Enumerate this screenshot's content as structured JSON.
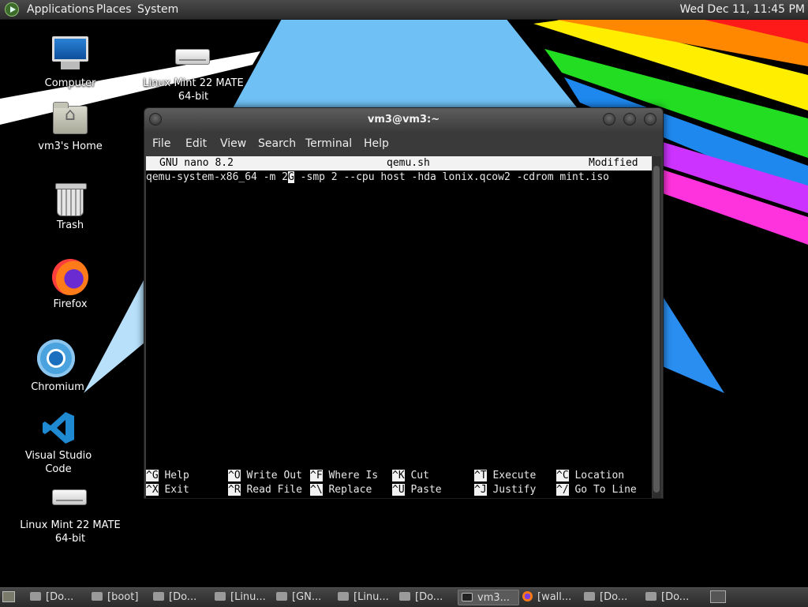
{
  "top_panel": {
    "menus": [
      "Applications",
      "Places",
      "System"
    ],
    "clock": "Wed Dec 11, 11:45 PM"
  },
  "desktop_icons": [
    {
      "label": "Computer",
      "icon": "computer-icon"
    },
    {
      "label": "Linux Mint 22 MATE 64-bit",
      "line1": "Linux Mint 22 MATE",
      "line2": "64-bit",
      "icon": "drive-icon"
    },
    {
      "label": "vm3's Home",
      "icon": "home-folder-icon"
    },
    {
      "label": "Trash",
      "icon": "trash-icon"
    },
    {
      "label": "Firefox",
      "icon": "firefox-icon"
    },
    {
      "label": "Chromium",
      "icon": "chromium-icon"
    },
    {
      "label": "Visual Studio Code",
      "icon": "vscode-icon"
    },
    {
      "label": "Linux Mint 22 MATE 64-bit",
      "line1": "Linux Mint 22 MATE",
      "line2": "64-bit",
      "icon": "drive-icon"
    }
  ],
  "window": {
    "title": "vm3@vm3:~",
    "menu": [
      "File",
      "Edit",
      "View",
      "Search",
      "Terminal",
      "Help"
    ]
  },
  "nano": {
    "version": "GNU nano 8.2",
    "filename": "qemu.sh",
    "status": "Modified",
    "line_before_cursor": "qemu-system-x86_64 -m 2",
    "cursor_char": "G",
    "line_after_cursor": " -smp 2 --cpu host -hda lonix.qcow2 -cdrom mint.iso",
    "shortcuts_row1": [
      {
        "key": "^G",
        "label": "Help"
      },
      {
        "key": "^O",
        "label": "Write Out"
      },
      {
        "key": "^F",
        "label": "Where Is"
      },
      {
        "key": "^K",
        "label": "Cut"
      },
      {
        "key": "^T",
        "label": "Execute"
      },
      {
        "key": "^C",
        "label": "Location"
      }
    ],
    "shortcuts_row2": [
      {
        "key": "^X",
        "label": "Exit"
      },
      {
        "key": "^R",
        "label": "Read File"
      },
      {
        "key": "^\\",
        "label": "Replace"
      },
      {
        "key": "^U",
        "label": "Paste"
      },
      {
        "key": "^J",
        "label": "Justify"
      },
      {
        "key": "^/",
        "label": "Go To Line"
      }
    ]
  },
  "taskbar": {
    "items": [
      {
        "label": "[Do...",
        "icon": "folder-icon"
      },
      {
        "label": "[boot]",
        "icon": "folder-icon"
      },
      {
        "label": "[Do...",
        "icon": "folder-icon"
      },
      {
        "label": "[Linu...",
        "icon": "drive-icon"
      },
      {
        "label": "[GN...",
        "icon": "image-icon"
      },
      {
        "label": "[Linu...",
        "icon": "drive-icon"
      },
      {
        "label": "[Do...",
        "icon": "folder-icon"
      },
      {
        "label": "vm3...",
        "icon": "terminal-icon",
        "active": true
      },
      {
        "label": "[wall...",
        "icon": "firefox-icon"
      },
      {
        "label": "[Do...",
        "icon": "folder-icon"
      },
      {
        "label": "[Do...",
        "icon": "folder-icon"
      }
    ]
  },
  "colors": {
    "terminal_bg": "#000000",
    "terminal_fg": "#e8e8e8",
    "nano_header_bg": "#f2f2f2",
    "panel_bg": "#3a3a3a"
  }
}
